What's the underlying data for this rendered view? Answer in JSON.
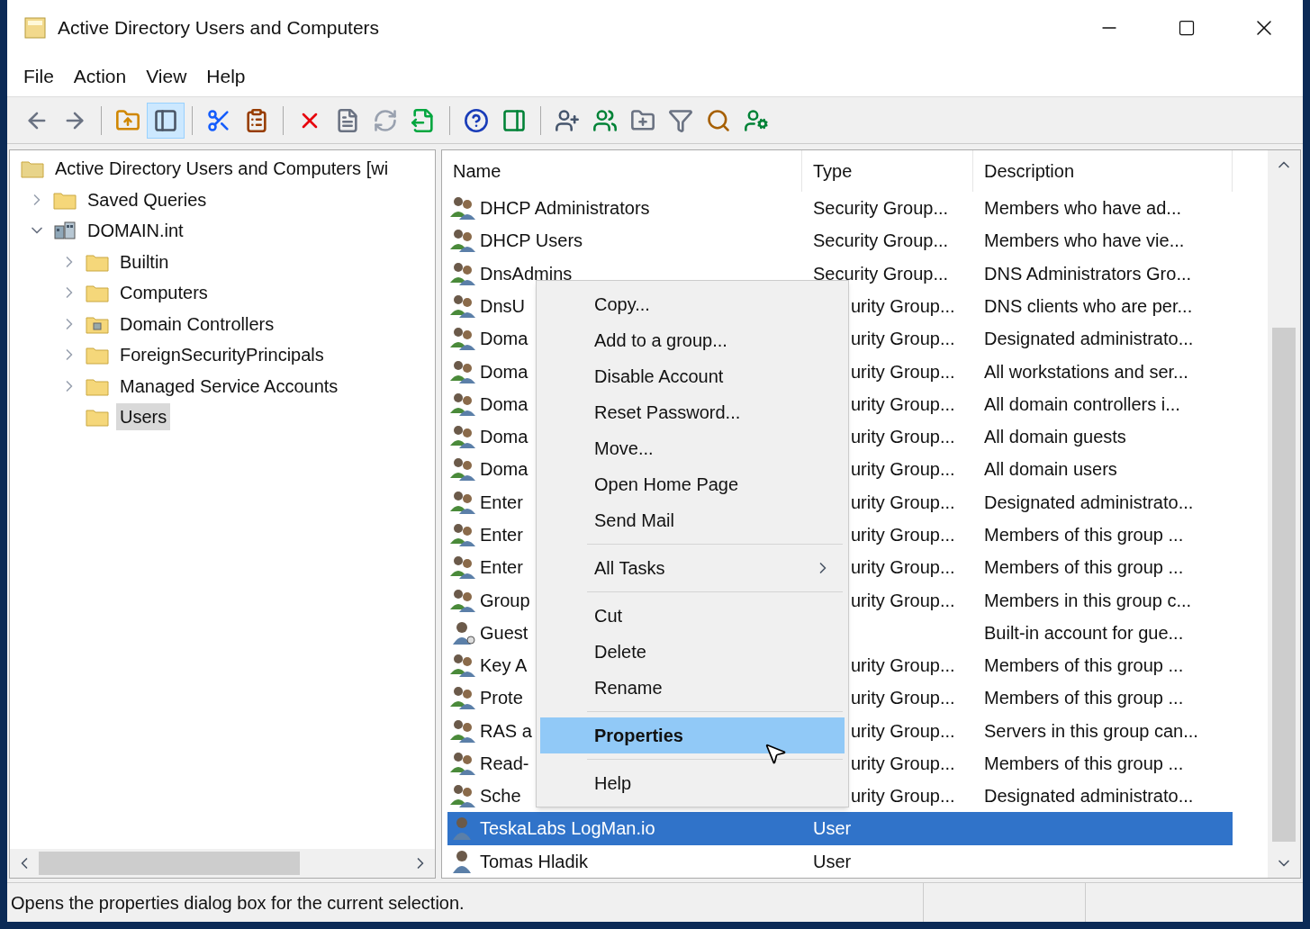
{
  "window": {
    "title": "Active Directory Users and Computers"
  },
  "menu": [
    "File",
    "Action",
    "View",
    "Help"
  ],
  "toolbar": [
    {
      "kind": "back",
      "selected": false
    },
    {
      "kind": "forward",
      "selected": false
    },
    {
      "kind": "sep"
    },
    {
      "kind": "up",
      "selected": false
    },
    {
      "kind": "console-tree",
      "selected": true
    },
    {
      "kind": "sep"
    },
    {
      "kind": "cut",
      "selected": false
    },
    {
      "kind": "paste",
      "selected": false
    },
    {
      "kind": "sep"
    },
    {
      "kind": "delete",
      "selected": false
    },
    {
      "kind": "properties",
      "selected": false
    },
    {
      "kind": "refresh",
      "selected": false
    },
    {
      "kind": "export",
      "selected": false
    },
    {
      "kind": "sep"
    },
    {
      "kind": "help",
      "selected": false
    },
    {
      "kind": "action-pane",
      "selected": false
    },
    {
      "kind": "sep"
    },
    {
      "kind": "new-user",
      "selected": false
    },
    {
      "kind": "new-group",
      "selected": false
    },
    {
      "kind": "new-ou",
      "selected": false
    },
    {
      "kind": "filter",
      "selected": false
    },
    {
      "kind": "find",
      "selected": false
    },
    {
      "kind": "add-member",
      "selected": false
    }
  ],
  "tree": {
    "label": "Active Directory Users and Computers [wi",
    "kind": "root",
    "selected": false,
    "children": [
      {
        "label": "Saved Queries",
        "kind": "folder",
        "expanded": false,
        "selected": false
      },
      {
        "label": "DOMAIN.int",
        "kind": "domain",
        "expanded": true,
        "selected": false,
        "children": [
          {
            "label": "Builtin",
            "kind": "folder",
            "expanded": false,
            "selected": false
          },
          {
            "label": "Computers",
            "kind": "folder",
            "expanded": false,
            "selected": false
          },
          {
            "label": "Domain Controllers",
            "kind": "ou",
            "expanded": false,
            "selected": false
          },
          {
            "label": "ForeignSecurityPrincipals",
            "kind": "folder",
            "expanded": false,
            "selected": false
          },
          {
            "label": "Managed Service Accounts",
            "kind": "folder",
            "expanded": false,
            "selected": false
          },
          {
            "label": "Users",
            "kind": "leaf",
            "selected": true
          }
        ]
      }
    ]
  },
  "list": {
    "columns": [
      "Name",
      "Type",
      "Description"
    ],
    "rows": [
      {
        "kind": "group",
        "name": "DHCP Administrators",
        "type": "Security Group...",
        "description": "Members who have ad...",
        "selected": false
      },
      {
        "kind": "group",
        "name": "DHCP Users",
        "type": "Security Group...",
        "description": "Members who have vie...",
        "selected": false
      },
      {
        "kind": "group",
        "name": "DnsAdmins",
        "type": "Security Group...",
        "description": "DNS Administrators Gro...",
        "selected": false
      },
      {
        "kind": "group",
        "name": "DnsU",
        "type": "urity Group...",
        "description": "DNS clients who are per...",
        "selected": false
      },
      {
        "kind": "group",
        "name": "Doma",
        "type": "urity Group...",
        "description": "Designated administrato...",
        "selected": false
      },
      {
        "kind": "group",
        "name": "Doma",
        "type": "urity Group...",
        "description": "All workstations and ser...",
        "selected": false
      },
      {
        "kind": "group",
        "name": "Doma",
        "type": "urity Group...",
        "description": "All domain controllers i...",
        "selected": false
      },
      {
        "kind": "group",
        "name": "Doma",
        "type": "urity Group...",
        "description": "All domain guests",
        "selected": false
      },
      {
        "kind": "group",
        "name": "Doma",
        "type": "urity Group...",
        "description": "All domain users",
        "selected": false
      },
      {
        "kind": "group",
        "name": "Enter",
        "type": "urity Group...",
        "description": "Designated administrato...",
        "selected": false
      },
      {
        "kind": "group",
        "name": "Enter",
        "type": "urity Group...",
        "description": "Members of this group ...",
        "selected": false
      },
      {
        "kind": "group",
        "name": "Enter",
        "type": "urity Group...",
        "description": "Members of this group ...",
        "selected": false
      },
      {
        "kind": "group",
        "name": "Group",
        "type": "urity Group...",
        "description": "Members in this group c...",
        "selected": false
      },
      {
        "kind": "guest",
        "name": "Guest",
        "description": "Built-in account for gue...",
        "selected": false
      },
      {
        "kind": "group",
        "name": "Key A",
        "type": "urity Group...",
        "description": "Members of this group ...",
        "selected": false
      },
      {
        "kind": "group",
        "name": "Prote",
        "type": "urity Group...",
        "description": "Members of this group ...",
        "selected": false
      },
      {
        "kind": "group",
        "name": "RAS a",
        "type": "urity Group...",
        "description": "Servers in this group can...",
        "selected": false
      },
      {
        "kind": "group",
        "name": "Read-",
        "type": "urity Group...",
        "description": "Members of this group ...",
        "selected": false
      },
      {
        "kind": "group",
        "name": "Sche",
        "type": "urity Group...",
        "description": "Designated administrato...",
        "selected": false
      },
      {
        "kind": "user",
        "name": "TeskaLabs LogMan.io",
        "type": "User",
        "selected": true
      },
      {
        "kind": "user",
        "name": "Tomas Hladik",
        "type": "User",
        "selected": false
      }
    ]
  },
  "context_menu": [
    {
      "kind": "item",
      "label": "Copy...",
      "selected": false,
      "default": false
    },
    {
      "kind": "item",
      "label": "Add to a group...",
      "selected": false,
      "default": false
    },
    {
      "kind": "item",
      "label": "Disable Account",
      "selected": false,
      "default": false
    },
    {
      "kind": "item",
      "label": "Reset Password...",
      "selected": false,
      "default": false
    },
    {
      "kind": "item",
      "label": "Move...",
      "selected": false,
      "default": false
    },
    {
      "kind": "item",
      "label": "Open Home Page",
      "selected": false,
      "default": false
    },
    {
      "kind": "item",
      "label": "Send Mail",
      "selected": false,
      "default": false
    },
    {
      "kind": "separator"
    },
    {
      "kind": "submenu",
      "label": "All Tasks",
      "selected": false,
      "default": false
    },
    {
      "kind": "separator"
    },
    {
      "kind": "item",
      "label": "Cut",
      "selected": false,
      "default": false
    },
    {
      "kind": "item",
      "label": "Delete",
      "selected": false,
      "default": false
    },
    {
      "kind": "item",
      "label": "Rename",
      "selected": false,
      "default": false
    },
    {
      "kind": "separator"
    },
    {
      "kind": "item",
      "label": "Properties",
      "selected": true,
      "default": true
    },
    {
      "kind": "separator"
    },
    {
      "kind": "item",
      "label": "Help",
      "selected": false,
      "default": false
    }
  ],
  "status_bar": {
    "text": "Opens the properties dialog box for the current selection."
  }
}
